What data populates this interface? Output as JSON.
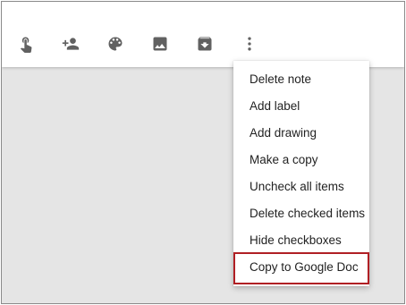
{
  "toolbar": {
    "icons": [
      {
        "name": "remind-me-icon",
        "label": "Remind me"
      },
      {
        "name": "collaborator-icon",
        "label": "Collaborator"
      },
      {
        "name": "change-color-icon",
        "label": "Change color"
      },
      {
        "name": "add-image-icon",
        "label": "Add image"
      },
      {
        "name": "archive-icon",
        "label": "Archive"
      },
      {
        "name": "more-icon",
        "label": "More"
      }
    ]
  },
  "menu": {
    "items": [
      {
        "label": "Delete note"
      },
      {
        "label": "Add label"
      },
      {
        "label": "Add drawing"
      },
      {
        "label": "Make a copy"
      },
      {
        "label": "Uncheck all items"
      },
      {
        "label": "Delete checked items"
      },
      {
        "label": "Hide checkboxes"
      },
      {
        "label": "Copy to Google Doc"
      }
    ],
    "highlighted_index": 7
  },
  "colors": {
    "icon": "#616161",
    "background": "#e5e5e5",
    "highlight_border": "#b01f24"
  }
}
